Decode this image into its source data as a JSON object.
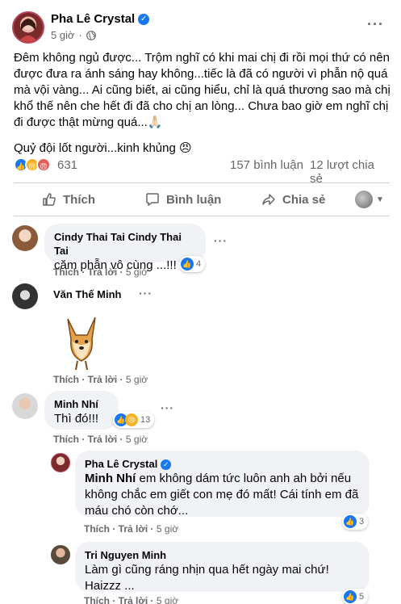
{
  "post": {
    "author": "Pha Lê Crystal",
    "time": "5 giờ",
    "paragraphs": [
      "Đêm không ngủ được... Trộm nghĩ có khi mai chị đi rồi mọi thứ có nên được đưa ra ánh sáng hay không...tiếc là đã có người vì phẫn nộ quá mà vội vàng... Ai cũng biết, ai cũng hiểu, chỉ là quá thương sao mà chị khổ thế nên che hết đi đã cho chị an lòng... Chưa bao giờ em nghĩ chị đi được thật mừng quá...🙏🏻",
      "Quỷ đội lốt người...kinh khủng 😠"
    ],
    "reaction_count": "631",
    "comments_count": "157 bình luận",
    "shares_count": "12 lượt chia sẻ"
  },
  "actions": {
    "like": "Thích",
    "comment": "Bình luận",
    "share": "Chia sẻ"
  },
  "comments": [
    {
      "author": "Cindy Thai Tai Cindy Thai Tai",
      "text": "căm phẫn vô cùng ...!!!",
      "like": "Thích",
      "reply": "Trả lời",
      "time": "5 giờ",
      "reactions": "4"
    },
    {
      "author": "Văn Thế Minh",
      "like": "Thích",
      "reply": "Trả lời",
      "time": "5 giờ"
    },
    {
      "author": "Minh Nhí",
      "text": "Thì đó!!!",
      "like": "Thích",
      "reply": "Trả lời",
      "time": "5 giờ",
      "reactions": "13"
    }
  ],
  "replies": [
    {
      "author": "Pha Lê Crystal",
      "mention": "Minh Nhí",
      "text": " em không dám tức luôn anh ah bởi nếu không chắc em giết con mẹ đó mất! Cái tính em đã máu chó còn chớ...",
      "like": "Thích",
      "reply": "Trả lời",
      "time": "5 giờ",
      "reactions": "3"
    },
    {
      "author": "Tri Nguyen Minh",
      "text": "Làm gì cũng ráng nhịn qua hết ngày mai chứ! Haizzz ...",
      "like": "Thích",
      "reply": "Trả lời",
      "time": "5 giờ",
      "reactions": "5"
    }
  ],
  "colors": {
    "accent": "#1877f2",
    "secondary_text": "#65676b",
    "bubble": "#f0f2f5"
  }
}
